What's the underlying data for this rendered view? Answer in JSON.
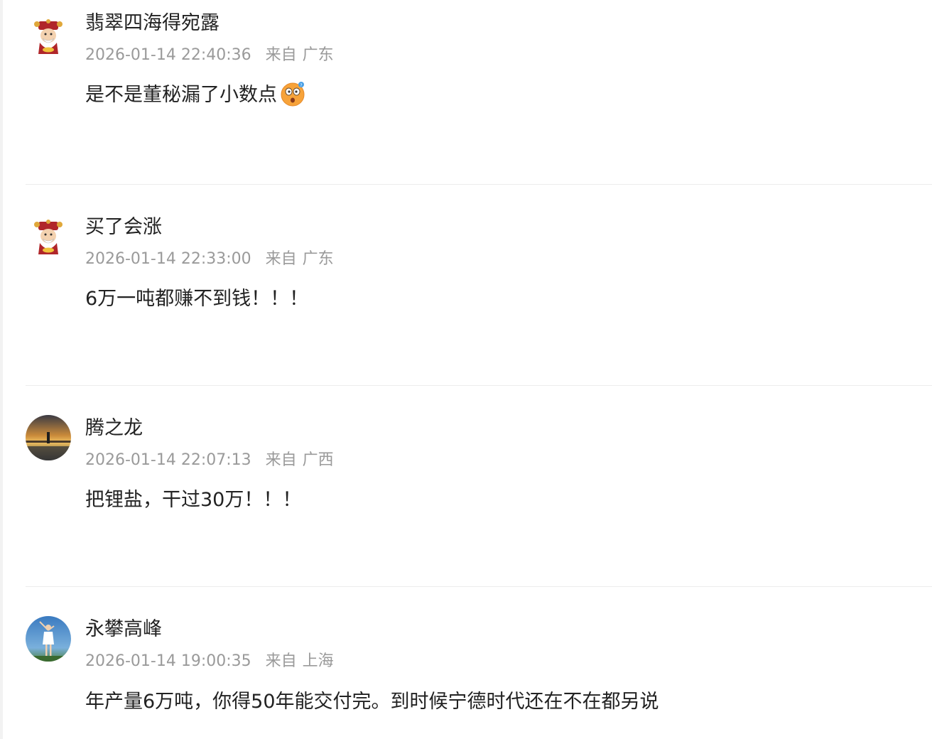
{
  "comments": [
    {
      "username": "翡翠四海得宛露",
      "time": "2026-01-14 22:40:36",
      "location_prefix": "来自",
      "location": "广东",
      "content": "是不是董秘漏了小数点",
      "emoji": "astonished-face-emoji",
      "avatar": "fortune-god-avatar"
    },
    {
      "username": "买了会涨",
      "time": "2026-01-14 22:33:00",
      "location_prefix": "来自",
      "location": "广东",
      "content": "6万一吨都赚不到钱！！！",
      "avatar": "fortune-god-avatar"
    },
    {
      "username": "腾之龙",
      "time": "2026-01-14 22:07:13",
      "location_prefix": "来自",
      "location": "广西",
      "content": "把锂盐，干过30万！！！",
      "avatar": "sunset-landscape-avatar"
    },
    {
      "username": "永攀高峰",
      "time": "2026-01-14 19:00:35",
      "location_prefix": "来自",
      "location": "上海",
      "content": "年产量6万吨，你得50年能交付完。到时候宁德时代还在不在都另说",
      "avatar": "person-sky-avatar"
    }
  ],
  "colors": {
    "username": "#222222",
    "meta": "#9a9a9a",
    "divider": "#ececec"
  }
}
